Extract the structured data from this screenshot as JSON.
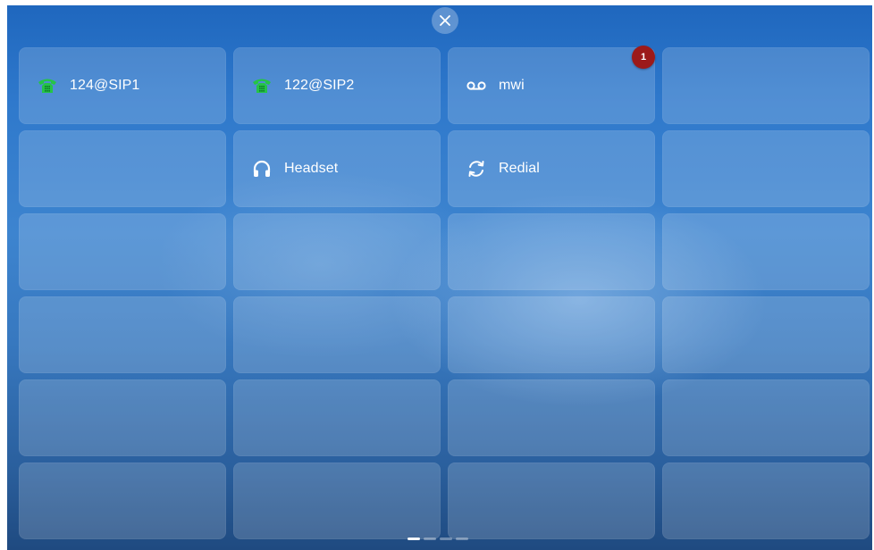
{
  "close_button": {
    "icon": "close-icon"
  },
  "keys": [
    {
      "label": "124@SIP1",
      "icon": "phone-icon",
      "icon_color": "#25c447"
    },
    {
      "label": "122@SIP2",
      "icon": "phone-icon",
      "icon_color": "#25c447"
    },
    {
      "label": "mwi",
      "icon": "voicemail-icon",
      "badge": "1",
      "badge_color": "#9c1a1a"
    },
    {
      "label": ""
    },
    {
      "label": ""
    },
    {
      "label": "Headset",
      "icon": "headset-icon"
    },
    {
      "label": "Redial",
      "icon": "redial-icon"
    },
    {
      "label": ""
    }
  ],
  "pager": {
    "pages": 4,
    "current": 1
  }
}
